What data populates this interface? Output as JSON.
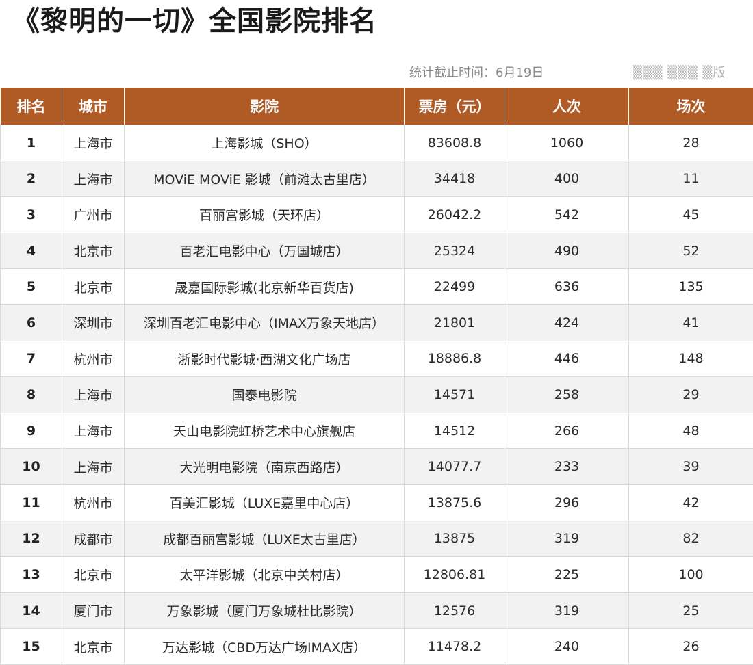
{
  "title": "《黎明的一切》全国影院排名",
  "meta": {
    "label": "统计截止时间：",
    "date": "6月19日"
  },
  "watermark": "▒▒▒ ▒▒▒ ▒版",
  "table": {
    "headers": [
      "排名",
      "城市",
      "影院",
      "票房（元）",
      "人次",
      "场次"
    ],
    "rows": [
      [
        "1",
        "上海市",
        "上海影城（SHO）",
        "83608.8",
        "1060",
        "28"
      ],
      [
        "2",
        "上海市",
        "MOViE MOViE 影城（前滩太古里店）",
        "34418",
        "400",
        "11"
      ],
      [
        "3",
        "广州市",
        "百丽宫影城（天环店）",
        "26042.2",
        "542",
        "45"
      ],
      [
        "4",
        "北京市",
        "百老汇电影中心（万国城店）",
        "25324",
        "490",
        "52"
      ],
      [
        "5",
        "北京市",
        "晟嘉国际影城(北京新华百货店)",
        "22499",
        "636",
        "135"
      ],
      [
        "6",
        "深圳市",
        "深圳百老汇电影中心（IMAX万象天地店）",
        "21801",
        "424",
        "41"
      ],
      [
        "7",
        "杭州市",
        "浙影时代影城·西湖文化广场店",
        "18886.8",
        "446",
        "148"
      ],
      [
        "8",
        "上海市",
        "国泰电影院",
        "14571",
        "258",
        "29"
      ],
      [
        "9",
        "上海市",
        "天山电影院虹桥艺术中心旗舰店",
        "14512",
        "266",
        "48"
      ],
      [
        "10",
        "上海市",
        "大光明电影院（南京西路店）",
        "14077.7",
        "233",
        "39"
      ],
      [
        "11",
        "杭州市",
        "百美汇影城（LUXE嘉里中心店）",
        "13875.6",
        "296",
        "42"
      ],
      [
        "12",
        "成都市",
        "成都百丽宫影城（LUXE太古里店）",
        "13875",
        "319",
        "82"
      ],
      [
        "13",
        "北京市",
        "太平洋影城（北京中关村店）",
        "12806.81",
        "225",
        "100"
      ],
      [
        "14",
        "厦门市",
        "万象影城（厦门万象城杜比影院）",
        "12576",
        "319",
        "25"
      ],
      [
        "15",
        "北京市",
        "万达影城（CBD万达广场IMAX店）",
        "11478.2",
        "240",
        "26"
      ]
    ]
  },
  "colors": {
    "header_bg": "#b05a26",
    "header_text": "#ffffff",
    "stripe": "#f2f2f2"
  }
}
